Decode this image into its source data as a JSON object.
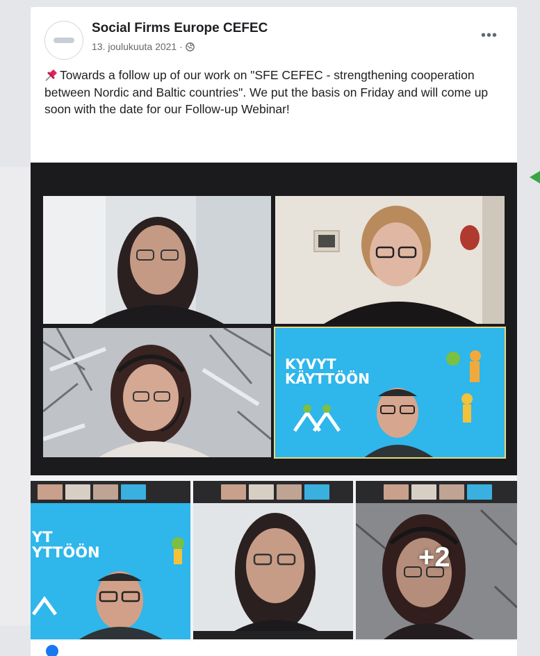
{
  "post": {
    "author": "Social Firms Europe CEFEC",
    "timestamp": "13. joulukuuta 2021 ·",
    "privacy_icon": "globe-icon",
    "pin_icon": "pushpin-icon",
    "text": "Towards a follow up of  our work on \"SFE CEFEC - strengthening cooperation between Nordic and Baltic countries\". We put the basis on Friday and will come up  soon  with the date for our Follow-up Webinar!",
    "more_icon": "more-options-icon"
  },
  "media": {
    "screen_share": {
      "line1": "KYVYT",
      "line2": "KÄYTTÖÖN"
    },
    "thumb_screen_share": {
      "line1": "YT",
      "line2": "YTTÖÖN"
    },
    "more_count": "+2"
  },
  "colors": {
    "accent": "#1877f2",
    "screen_share_bg": "#2fb6ea",
    "active_speaker_border": "#e8d97a"
  }
}
